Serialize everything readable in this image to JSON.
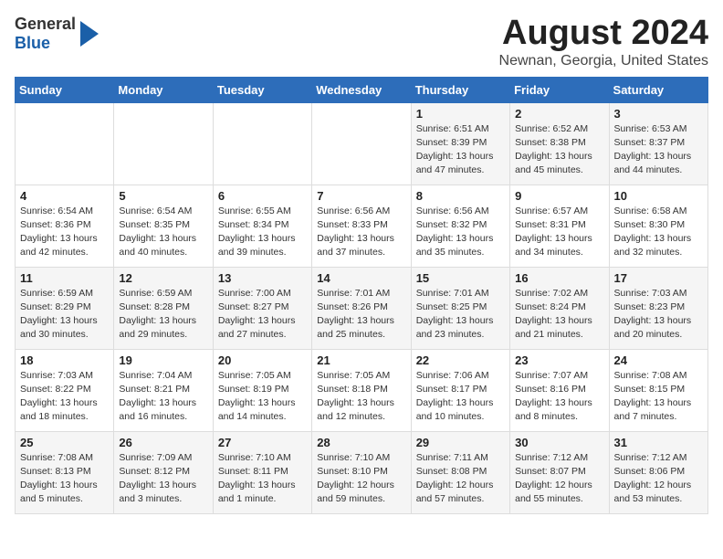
{
  "header": {
    "logo_line1": "General",
    "logo_line2": "Blue",
    "title": "August 2024",
    "subtitle": "Newnan, Georgia, United States"
  },
  "days_of_week": [
    "Sunday",
    "Monday",
    "Tuesday",
    "Wednesday",
    "Thursday",
    "Friday",
    "Saturday"
  ],
  "weeks": [
    [
      {
        "day": "",
        "info": ""
      },
      {
        "day": "",
        "info": ""
      },
      {
        "day": "",
        "info": ""
      },
      {
        "day": "",
        "info": ""
      },
      {
        "day": "1",
        "info": "Sunrise: 6:51 AM\nSunset: 8:39 PM\nDaylight: 13 hours\nand 47 minutes."
      },
      {
        "day": "2",
        "info": "Sunrise: 6:52 AM\nSunset: 8:38 PM\nDaylight: 13 hours\nand 45 minutes."
      },
      {
        "day": "3",
        "info": "Sunrise: 6:53 AM\nSunset: 8:37 PM\nDaylight: 13 hours\nand 44 minutes."
      }
    ],
    [
      {
        "day": "4",
        "info": "Sunrise: 6:54 AM\nSunset: 8:36 PM\nDaylight: 13 hours\nand 42 minutes."
      },
      {
        "day": "5",
        "info": "Sunrise: 6:54 AM\nSunset: 8:35 PM\nDaylight: 13 hours\nand 40 minutes."
      },
      {
        "day": "6",
        "info": "Sunrise: 6:55 AM\nSunset: 8:34 PM\nDaylight: 13 hours\nand 39 minutes."
      },
      {
        "day": "7",
        "info": "Sunrise: 6:56 AM\nSunset: 8:33 PM\nDaylight: 13 hours\nand 37 minutes."
      },
      {
        "day": "8",
        "info": "Sunrise: 6:56 AM\nSunset: 8:32 PM\nDaylight: 13 hours\nand 35 minutes."
      },
      {
        "day": "9",
        "info": "Sunrise: 6:57 AM\nSunset: 8:31 PM\nDaylight: 13 hours\nand 34 minutes."
      },
      {
        "day": "10",
        "info": "Sunrise: 6:58 AM\nSunset: 8:30 PM\nDaylight: 13 hours\nand 32 minutes."
      }
    ],
    [
      {
        "day": "11",
        "info": "Sunrise: 6:59 AM\nSunset: 8:29 PM\nDaylight: 13 hours\nand 30 minutes."
      },
      {
        "day": "12",
        "info": "Sunrise: 6:59 AM\nSunset: 8:28 PM\nDaylight: 13 hours\nand 29 minutes."
      },
      {
        "day": "13",
        "info": "Sunrise: 7:00 AM\nSunset: 8:27 PM\nDaylight: 13 hours\nand 27 minutes."
      },
      {
        "day": "14",
        "info": "Sunrise: 7:01 AM\nSunset: 8:26 PM\nDaylight: 13 hours\nand 25 minutes."
      },
      {
        "day": "15",
        "info": "Sunrise: 7:01 AM\nSunset: 8:25 PM\nDaylight: 13 hours\nand 23 minutes."
      },
      {
        "day": "16",
        "info": "Sunrise: 7:02 AM\nSunset: 8:24 PM\nDaylight: 13 hours\nand 21 minutes."
      },
      {
        "day": "17",
        "info": "Sunrise: 7:03 AM\nSunset: 8:23 PM\nDaylight: 13 hours\nand 20 minutes."
      }
    ],
    [
      {
        "day": "18",
        "info": "Sunrise: 7:03 AM\nSunset: 8:22 PM\nDaylight: 13 hours\nand 18 minutes."
      },
      {
        "day": "19",
        "info": "Sunrise: 7:04 AM\nSunset: 8:21 PM\nDaylight: 13 hours\nand 16 minutes."
      },
      {
        "day": "20",
        "info": "Sunrise: 7:05 AM\nSunset: 8:19 PM\nDaylight: 13 hours\nand 14 minutes."
      },
      {
        "day": "21",
        "info": "Sunrise: 7:05 AM\nSunset: 8:18 PM\nDaylight: 13 hours\nand 12 minutes."
      },
      {
        "day": "22",
        "info": "Sunrise: 7:06 AM\nSunset: 8:17 PM\nDaylight: 13 hours\nand 10 minutes."
      },
      {
        "day": "23",
        "info": "Sunrise: 7:07 AM\nSunset: 8:16 PM\nDaylight: 13 hours\nand 8 minutes."
      },
      {
        "day": "24",
        "info": "Sunrise: 7:08 AM\nSunset: 8:15 PM\nDaylight: 13 hours\nand 7 minutes."
      }
    ],
    [
      {
        "day": "25",
        "info": "Sunrise: 7:08 AM\nSunset: 8:13 PM\nDaylight: 13 hours\nand 5 minutes."
      },
      {
        "day": "26",
        "info": "Sunrise: 7:09 AM\nSunset: 8:12 PM\nDaylight: 13 hours\nand 3 minutes."
      },
      {
        "day": "27",
        "info": "Sunrise: 7:10 AM\nSunset: 8:11 PM\nDaylight: 13 hours\nand 1 minute."
      },
      {
        "day": "28",
        "info": "Sunrise: 7:10 AM\nSunset: 8:10 PM\nDaylight: 12 hours\nand 59 minutes."
      },
      {
        "day": "29",
        "info": "Sunrise: 7:11 AM\nSunset: 8:08 PM\nDaylight: 12 hours\nand 57 minutes."
      },
      {
        "day": "30",
        "info": "Sunrise: 7:12 AM\nSunset: 8:07 PM\nDaylight: 12 hours\nand 55 minutes."
      },
      {
        "day": "31",
        "info": "Sunrise: 7:12 AM\nSunset: 8:06 PM\nDaylight: 12 hours\nand 53 minutes."
      }
    ]
  ]
}
